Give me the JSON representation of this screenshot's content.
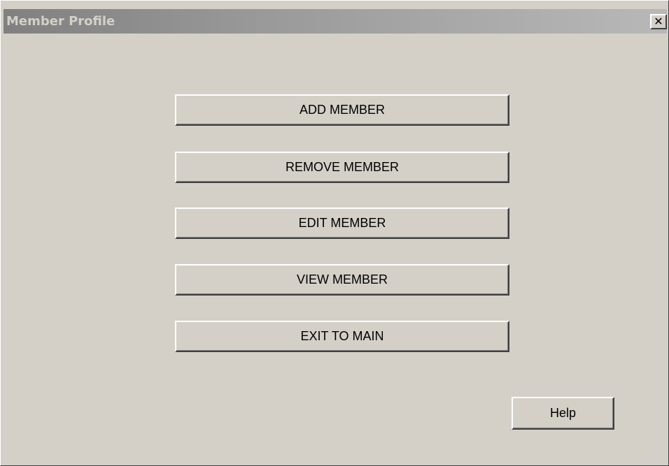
{
  "window": {
    "title": "Member Profile",
    "close_glyph": "✕"
  },
  "menu": {
    "add_member": "ADD MEMBER",
    "remove_member": "REMOVE MEMBER",
    "edit_member": "EDIT MEMBER",
    "view_member": "VIEW MEMBER",
    "exit_to_main": "EXIT TO MAIN"
  },
  "help": {
    "label": "Help"
  },
  "colors": {
    "face": "#d4d0c8",
    "titlebar_inactive": "#808080",
    "text": "#000000"
  }
}
